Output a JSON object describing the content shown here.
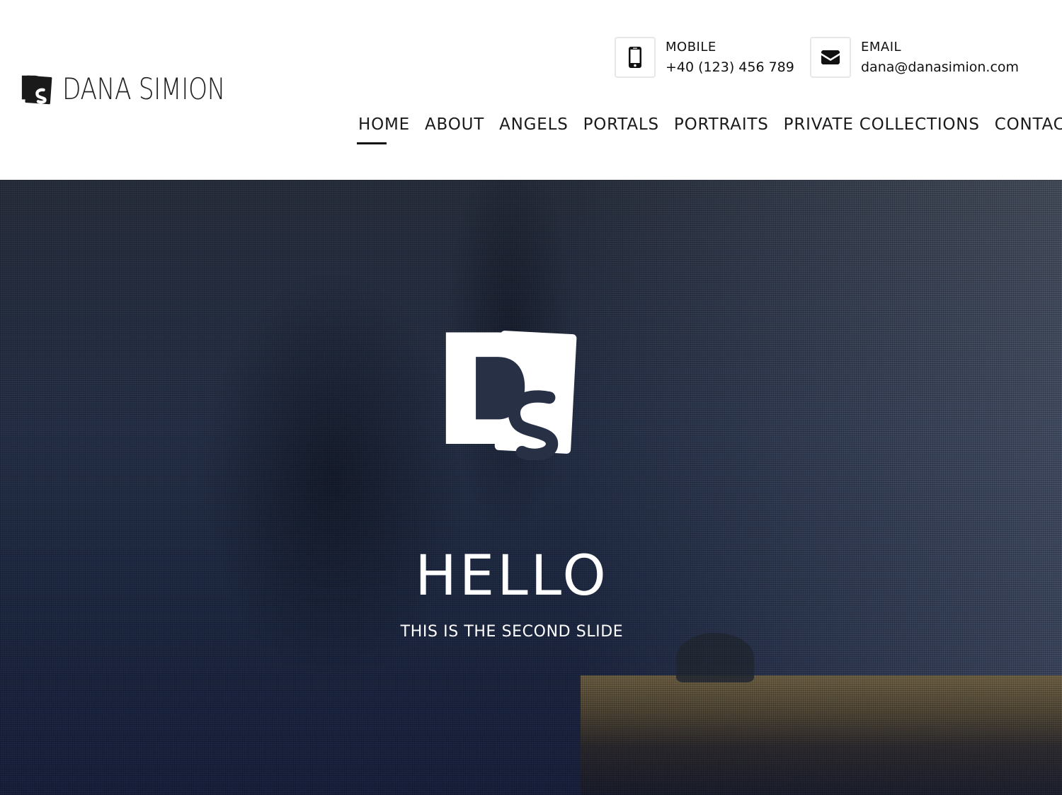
{
  "brand": {
    "name": "DANA SIMION",
    "logo_icon": "ds-monogram-icon"
  },
  "contacts": {
    "mobile": {
      "icon": "mobile-phone-icon",
      "label": "MOBILE",
      "value": "+40 (123) 456 789"
    },
    "email": {
      "icon": "envelope-icon",
      "label": "EMAIL",
      "value": "dana@danasimion.com"
    }
  },
  "nav": {
    "items": [
      {
        "label": "HOME",
        "active": true
      },
      {
        "label": "ABOUT"
      },
      {
        "label": "ANGELS"
      },
      {
        "label": "PORTALS"
      },
      {
        "label": "PORTRAITS"
      },
      {
        "label": "PRIVATE COLLECTIONS"
      },
      {
        "label": "CONTACT"
      }
    ]
  },
  "hero": {
    "logo_icon": "ds-monogram-icon",
    "title": "HELLO",
    "subtitle": "THIS IS THE SECOND SLIDE"
  },
  "colors": {
    "text": "#111111",
    "hero_overlay": "#1e2538",
    "hero_text": "#ffffff",
    "sand": "#8c7442"
  }
}
